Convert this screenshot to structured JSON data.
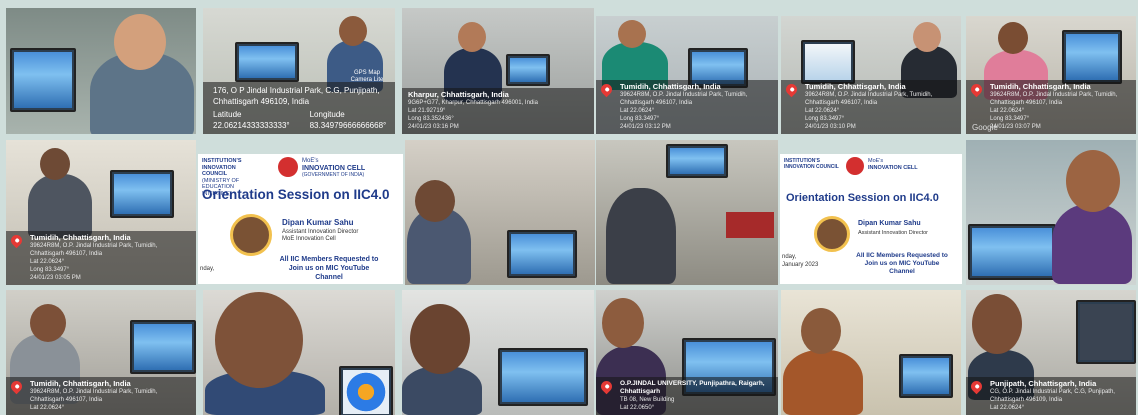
{
  "photos": {
    "r1c2": {
      "address": "176, O P Jindal Industrial Park, C.G, Punjipath, Chhattisgarh 496109, India",
      "lat_label": "Latitude",
      "lon_label": "Longitude",
      "lat": "22.06214333333333°",
      "lon": "83.34979666666668°",
      "badge": "GPS Map Camera Lite"
    },
    "r1c3": {
      "place": "Kharpur, Chhattisgarh, India",
      "address": "9G6P+G77, Kharpur, Chhattisgarh 496001, India",
      "lat": "Lat 21.92719°",
      "lon": "Long 83.352436°",
      "time": "24/01/23 03:16 PM"
    },
    "r1c4": {
      "place": "Tumidih, Chhattisgarh, India",
      "address": "39624R8M, O.P. Jindal Industrial Park, Tumidih, Chhattisgarh 496107, India",
      "lat": "Lat 22.0624°",
      "lon": "Long 83.3497°",
      "time": "24/01/23 03:12 PM"
    },
    "r1c5": {
      "place": "Tumidih, Chhattisgarh, India",
      "address": "39624R8M, O.P. Jindal Industrial Park, Tumidih, Chhattisgarh 496107, India",
      "lat": "Lat 22.0624°",
      "lon": "Long 83.3497°",
      "time": "24/01/23 03:10 PM"
    },
    "r1c6": {
      "place": "Tumidih, Chhattisgarh, India",
      "address": "39624R8M, O.P. Jindal Industrial Park, Tumidih, Chhattisgarh 496107, India",
      "lat": "Lat 22.0624°",
      "lon": "Long 83.3497°",
      "time": "24/01/23 03:07 PM"
    },
    "r2c1": {
      "place": "Tumidih, Chhattisgarh, India",
      "address": "39624R8M, O.P. Jindal Industrial Park, Tumidih, Chhattisgarh 496107, India",
      "lat": "Lat 22.0624°",
      "lon": "Long 83.3497°",
      "time": "24/01/23 03:05 PM"
    },
    "r3c1": {
      "place": "Tumidih, Chhattisgarh, India",
      "address": "39624R8M, O.P. Jindal Industrial Park, Tumidih, Chhattisgarh 496107, India",
      "lat": "Lat 22.0624°"
    },
    "r3c4": {
      "address": "O.P.JINDAL UNIVERSITY, Punjipathra, Raigarh, Chhattisgarh",
      "extra": "TB 08, New Building",
      "lat": "Lat 22.0650°"
    },
    "r3c6": {
      "place": "Punjipath, Chhattisgarh, India",
      "address": "CG, O.P. Jindal Industrial Park, C.G, Punjipath, Chhattisgarh 496109, India",
      "lat": "Lat 22.0624°"
    }
  },
  "poster": {
    "institution": "INSTITUTION'S INNOVATION COUNCIL",
    "ministry": "(MINISTRY OF EDUCATION INITIATIVE)",
    "cell_line1": "MoE's",
    "cell_line2": "INNOVATION CELL",
    "cell_line3": "(GOVERNMENT OF INDIA)",
    "title": "Orientation Session on IIC4.0",
    "speaker_name": "Dipan Kumar Sahu",
    "speaker_role1": "Assistant Innovation Director",
    "speaker_role2": "MoE Innovation Cell",
    "cta": "All IIC Members Requested to Join us on MIC YouTube Channel",
    "day_frag": "nday,",
    "date_frag": "January 2023"
  },
  "google": "Google"
}
